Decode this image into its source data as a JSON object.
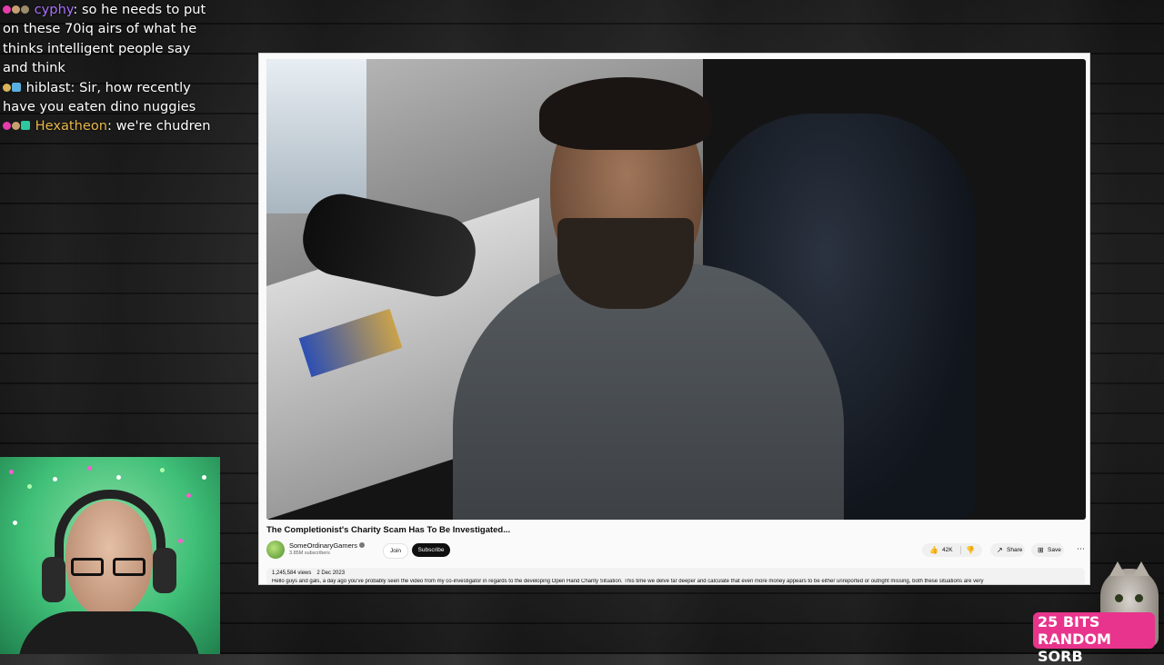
{
  "chat": {
    "messages": [
      {
        "user": "cyphy",
        "text": ": so he needs to put on these 70iq airs of what he thinks intelligent people say and think",
        "user_color": "#a970ff",
        "badges": [
          "#e63cac",
          "#c8a070",
          "#9b8c6a"
        ]
      },
      {
        "user": "hiblast",
        "text": ": Sir, how recently have you eaten dino nuggies",
        "user_color": "#ffffff",
        "badges": [
          "#d9b45a",
          "#5ab0e0"
        ]
      },
      {
        "user": "Hexatheon",
        "text": ": we're chudren",
        "user_color": "#e8b84a",
        "badges": [
          "#e63cac",
          "#c8a070",
          "#2ec7a0"
        ]
      }
    ]
  },
  "youtube": {
    "video_title": "The Completionist's Charity Scam Has To Be Investigated...",
    "channel_name": "SomeOrdinaryGamers",
    "subscribers": "3.85M subscribers",
    "join_label": "Join",
    "subscribe_label": "Subscribe",
    "like_count": "42K",
    "share_label": "Share",
    "save_label": "Save",
    "more_icon": "⋯",
    "views": "1,245,584 views",
    "date": "2 Dec 2023",
    "description": "Hello guys and gals, a day ago you've probably seen the video from my co-investigator in regards to the developing Open Hand Charity Situation. This time we delve far deeper and calculate that even more money appears to be either unreported or outright missing, both these situations are very"
  },
  "alert": {
    "line1": "25 BITS",
    "line2": "RANDOM SORB",
    "color": "#e8348c"
  },
  "icons": [
    "like-icon",
    "dislike-icon",
    "share-icon",
    "save-icon",
    "verified-icon",
    "more-icon"
  ]
}
